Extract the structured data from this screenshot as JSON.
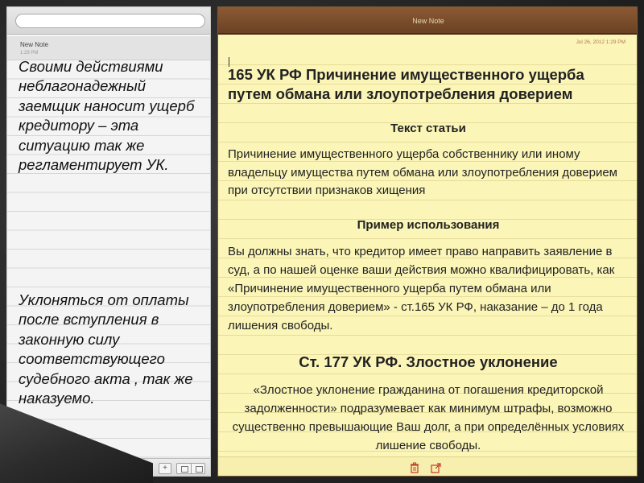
{
  "sidebar": {
    "search_placeholder": "",
    "note_item": {
      "title": "New Note",
      "time": "1:29 PM"
    },
    "text_block_1": "Своими действиями неблагонадежный заемщик наносит ущерб кредитору – эта ситуацию так же регламентирует УК.",
    "text_block_2": "Уклоняться от оплаты после вступления в законную силу соответствующего судебного акта , так же наказуемо.",
    "footer": {
      "add_label": "+"
    }
  },
  "note": {
    "header_title": "New Note",
    "date": "Jul 26, 2012 1:29 PM",
    "heading1": "165 УК РФ Причинение имущественного ущерба путем обмана или злоупотребления доверием",
    "subheading1": "Текст статьи",
    "body1": "Причинение имущественного ущерба собственнику или иному владельцу имущества путем обмана или злоупотребления доверием при отсутствии признаков хищения",
    "subheading2": "Пример использования",
    "body2": "Вы должны знать, что кредитор имеет право направить заявление в суд, а по нашей оценке ваши действия можно квалифицировать, как «Причинение имущественного ущерба путем обмана или злоупотребления доверием» - ст.165 УК РФ, наказание – до 1 года лишения свободы.",
    "heading2": "Ст. 177 УК РФ. Злостное уклонение",
    "body3": "«Злостное уклонение гражданина от погашения кредиторской задолженности» подразумевает как минимум штрафы, возможно существенно превышающие Ваш долг, а при определённых условиях лишение свободы."
  },
  "icons": {
    "search": "search-icon",
    "trash": "trash-icon",
    "share": "share-icon"
  },
  "colors": {
    "note_paper": "#fbf5b7",
    "header_leather": "#7a4c2a",
    "sidebar_bg": "#f4f4f4"
  }
}
